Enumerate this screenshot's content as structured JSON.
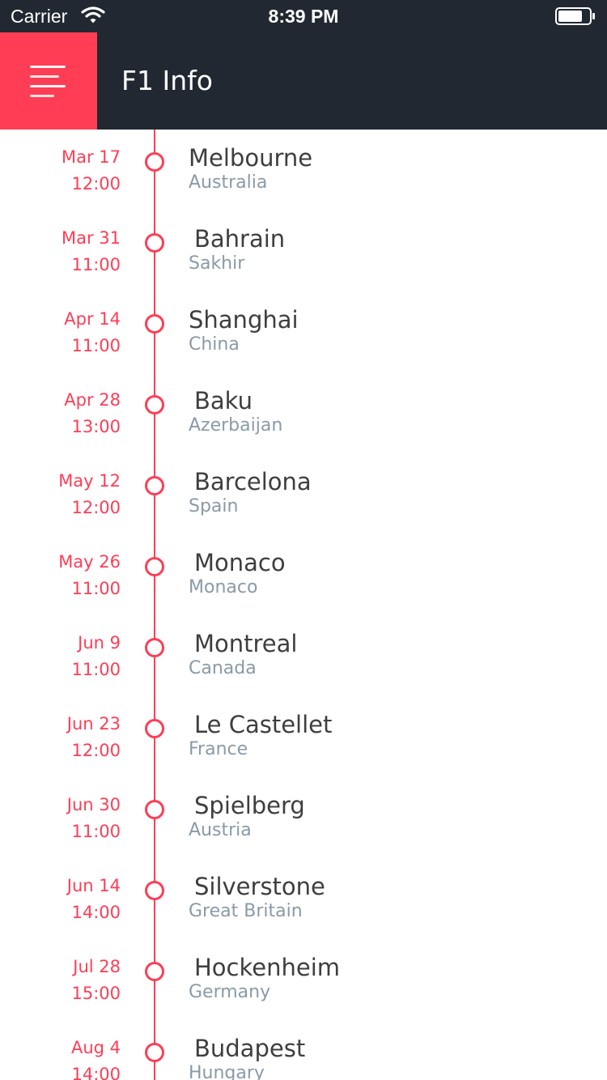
{
  "status_bar": {
    "carrier": "Carrier",
    "time": "8:39 PM",
    "wifi_icon": "wifi-icon",
    "battery_icon": "battery-icon"
  },
  "nav": {
    "title": "F1 Info",
    "menu_icon": "menu-icon",
    "accent_color": "#ff3d55",
    "bar_color": "#222831"
  },
  "races": [
    {
      "date": "Mar 17",
      "time": "12:00",
      "city": "Melbourne",
      "country": "Australia"
    },
    {
      "date": "Mar 31",
      "time": "11:00",
      "city": "Bahrain",
      "country": "Sakhir"
    },
    {
      "date": "Apr 14",
      "time": "11:00",
      "city": "Shanghai",
      "country": "China"
    },
    {
      "date": "Apr 28",
      "time": "13:00",
      "city": "Baku",
      "country": "Azerbaijan"
    },
    {
      "date": "May 12",
      "time": "12:00",
      "city": "Barcelona",
      "country": "Spain"
    },
    {
      "date": "May 26",
      "time": "11:00",
      "city": "Monaco",
      "country": "Monaco"
    },
    {
      "date": "Jun 9",
      "time": "11:00",
      "city": "Montreal",
      "country": "Canada"
    },
    {
      "date": "Jun 23",
      "time": "12:00",
      "city": "Le Castellet",
      "country": "France"
    },
    {
      "date": "Jun 30",
      "time": "11:00",
      "city": "Spielberg",
      "country": "Austria"
    },
    {
      "date": "Jun 14",
      "time": "14:00",
      "city": "Silverstone",
      "country": "Great Britain"
    },
    {
      "date": "Jul 28",
      "time": "15:00",
      "city": "Hockenheim",
      "country": "Germany"
    },
    {
      "date": "Aug 4",
      "time": "14:00",
      "city": "Budapest",
      "country": "Hungary"
    }
  ]
}
